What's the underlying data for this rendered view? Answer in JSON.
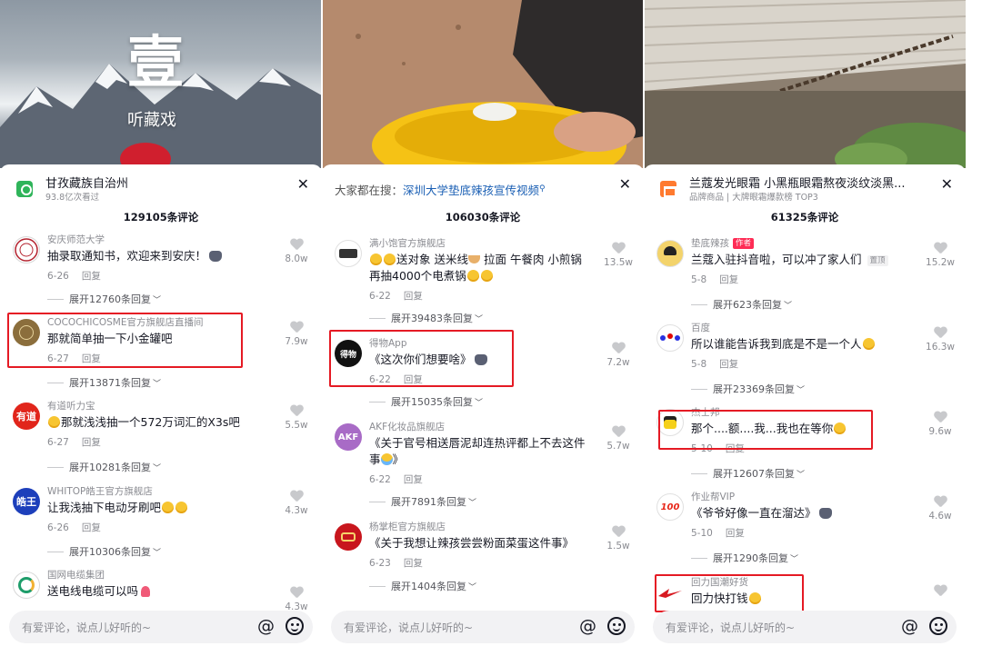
{
  "panels": [
    {
      "header": {
        "title": "甘孜藏族自治州",
        "subtitle": "93.8亿次看过"
      },
      "hero_text": {
        "big": "壹",
        "small": "听藏戏"
      },
      "comment_count": "129105条评论",
      "comments": [
        {
          "name": "安庆师范大学",
          "text": "抽录取通知书，欢迎来到安庆！",
          "date": "6-26",
          "reply": "回复",
          "likes": "8.0w",
          "expand": "展开12760条回复"
        },
        {
          "name": "COCOCHICOSME官方旗舰店直播间",
          "text": "那就简单抽一下小金罐吧",
          "date": "6-27",
          "reply": "回复",
          "likes": "7.9w",
          "expand": "展开13871条回复"
        },
        {
          "name": "有道听力宝",
          "text": "那就浅浅抽一个572万词汇的X3s吧",
          "date": "6-27",
          "reply": "回复",
          "likes": "5.5w",
          "expand": "展开10281条回复",
          "avatar_text": "有道"
        },
        {
          "name": "WHITOP皓王官方旗舰店",
          "text": "让我浅抽下电动牙刷吧",
          "date": "6-26",
          "reply": "回复",
          "likes": "4.3w",
          "expand": "展开10306条回复",
          "avatar_text": "皓王"
        },
        {
          "name": "国网电缆集团",
          "text": "送电线电缆可以吗",
          "likes": "4.3w"
        }
      ],
      "input_placeholder": "有爱评论，说点儿好听的~"
    },
    {
      "header": {
        "search_prefix": "大家都在搜：",
        "search_query": "深圳大学垫底辣孩宣传视频"
      },
      "comment_count": "106030条评论",
      "comments": [
        {
          "name": "满小饱官方旗舰店",
          "text_a": "送对象 送米线",
          "text_b": "拉面 午餐肉 小煎锅再抽4000个电煮锅",
          "date": "6-22",
          "reply": "回复",
          "likes": "13.5w",
          "expand": "展开39483条回复"
        },
        {
          "name": "得物App",
          "text": "《这次你们想要啥》",
          "date": "6-22",
          "reply": "回复",
          "likes": "7.2w",
          "expand": "展开15035条回复",
          "avatar_text": "得物"
        },
        {
          "name": "AKF化妆品旗舰店",
          "text": "《关于官号相送唇泥却连热评都上不去这件事",
          "text_end": "》",
          "date": "6-22",
          "reply": "回复",
          "likes": "5.7w",
          "expand": "展开7891条回复",
          "avatar_text": "AKF"
        },
        {
          "name": "杨掌柜官方旗舰店",
          "text": "《关于我想让辣孩尝尝粉面菜蛋这件事》",
          "date": "6-23",
          "reply": "回复",
          "likes": "1.5w",
          "expand": "展开1404条回复"
        }
      ],
      "input_placeholder": "有爱评论，说点儿好听的~"
    },
    {
      "header": {
        "title": "兰蔻发光眼霜 小黑瓶眼霜熬夜淡纹淡黑...",
        "subtitle": "品牌商品 | 大牌眼霜爆款榜 TOP3"
      },
      "comment_count": "61325条评论",
      "comments": [
        {
          "name": "垫底辣孩",
          "author_tag": "作者",
          "text": "兰蔻入驻抖音啦，可以冲了家人们",
          "pin": "置顶",
          "date": "5-8",
          "reply": "回复",
          "likes": "15.2w",
          "expand": "展开623条回复"
        },
        {
          "name": "百度",
          "text": "所以谁能告诉我到底是不是一个人",
          "date": "5-8",
          "reply": "回复",
          "likes": "16.3w",
          "expand": "展开23369条回复"
        },
        {
          "name": "杰士邦",
          "text": "那个....额....我...我也在等你",
          "date": "5-10",
          "reply": "回复",
          "likes": "9.6w",
          "expand": "展开12607条回复"
        },
        {
          "name": "作业帮VIP",
          "text": "《爷爷好像一直在溜达》",
          "date": "5-10",
          "reply": "回复",
          "likes": "4.6w",
          "expand": "展开1290条回复",
          "avatar_text": "100"
        },
        {
          "name": "回力国潮好货",
          "text": "回力快打钱"
        }
      ],
      "input_placeholder": "有爱评论，说点儿好听的~"
    }
  ]
}
